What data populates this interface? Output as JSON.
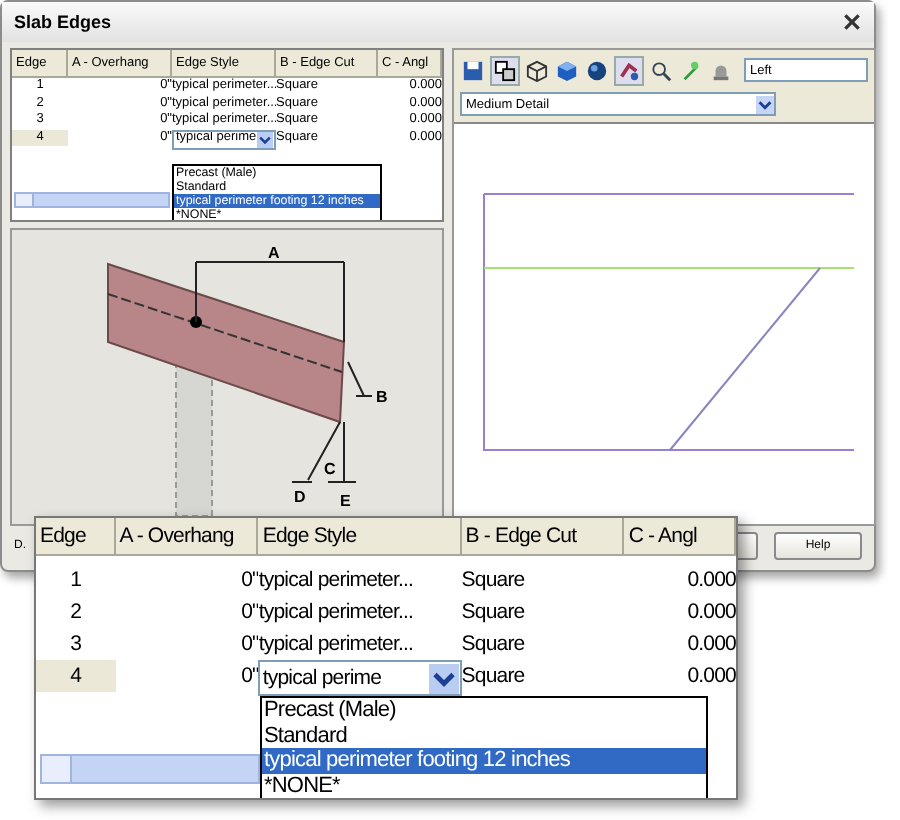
{
  "dialog": {
    "title": "Slab Edges",
    "table": {
      "columns": [
        "Edge",
        "A - Overhang",
        "Edge Style",
        "B - Edge Cut",
        "C - Angl"
      ],
      "rows": [
        {
          "edge": "1",
          "overhang": "0\"",
          "style": "typical perimeter...",
          "cut": "Square",
          "angle": "0.000",
          "selected": false
        },
        {
          "edge": "2",
          "overhang": "0\"",
          "style": "typical perimeter...",
          "cut": "Square",
          "angle": "0.000",
          "selected": false
        },
        {
          "edge": "3",
          "overhang": "0\"",
          "style": "typical perimeter...",
          "cut": "Square",
          "angle": "0.000",
          "selected": false
        },
        {
          "edge": "4",
          "overhang": "0\"",
          "style": "typical perime",
          "cut": "Square",
          "angle": "0.000",
          "selected": true
        }
      ],
      "options": [
        {
          "label": "Precast (Male)",
          "selected": false
        },
        {
          "label": "Standard",
          "selected": false
        },
        {
          "label": "typical perimeter footing 12 inches",
          "selected": true
        },
        {
          "label": "*NONE*",
          "selected": false
        }
      ]
    },
    "diagram_labels": [
      "A",
      "B",
      "C",
      "D",
      "E"
    ],
    "view_name": "Left",
    "detail_level": "Medium Detail",
    "bottom_label": "D.",
    "buttons": [
      "Help"
    ]
  },
  "callout": {
    "table": {
      "columns": [
        "Edge",
        "A - Overhang",
        "Edge Style",
        "B - Edge Cut",
        "C - Angl"
      ],
      "rows": [
        {
          "edge": "1",
          "overhang": "0\"",
          "style": "typical perimeter...",
          "cut": "Square",
          "angle": "0.000",
          "selected": false
        },
        {
          "edge": "2",
          "overhang": "0\"",
          "style": "typical perimeter...",
          "cut": "Square",
          "angle": "0.000",
          "selected": false
        },
        {
          "edge": "3",
          "overhang": "0\"",
          "style": "typical perimeter...",
          "cut": "Square",
          "angle": "0.000",
          "selected": false
        },
        {
          "edge": "4",
          "overhang": "0\"",
          "style": "typical perime",
          "cut": "Square",
          "angle": "0.000",
          "selected": true
        }
      ],
      "options": [
        {
          "label": "Precast (Male)",
          "selected": false
        },
        {
          "label": "Standard",
          "selected": false
        },
        {
          "label": "typical perimeter footing 12 inches",
          "selected": true
        },
        {
          "label": "*NONE*",
          "selected": false
        }
      ]
    }
  }
}
